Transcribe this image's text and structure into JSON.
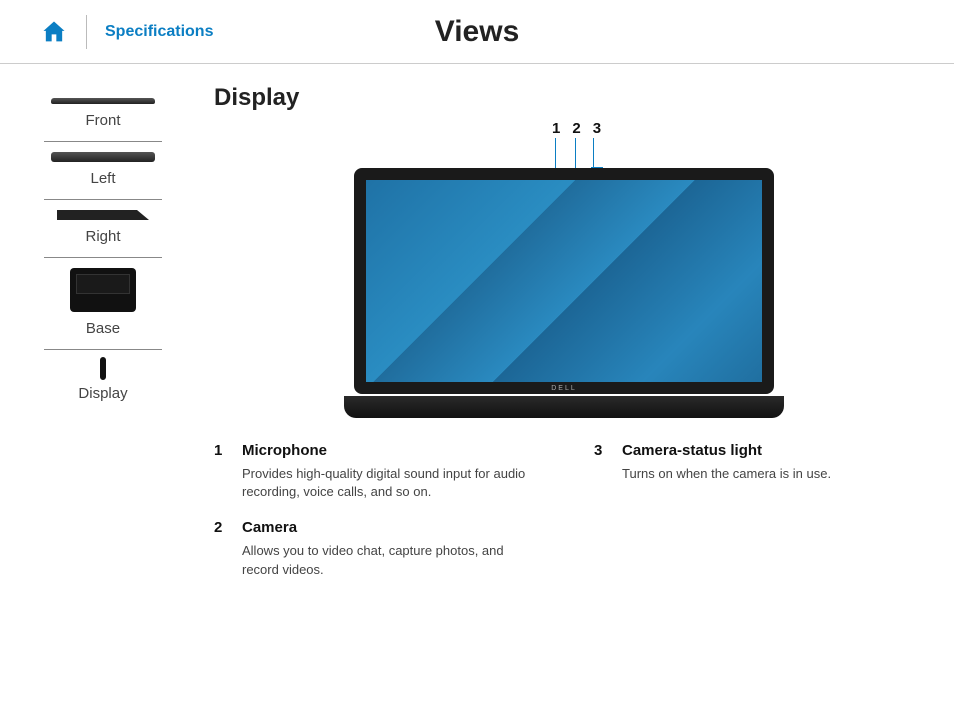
{
  "header": {
    "specifications_label": "Specifications",
    "page_title": "Views"
  },
  "sidebar": {
    "items": [
      {
        "label": "Front"
      },
      {
        "label": "Left"
      },
      {
        "label": "Right"
      },
      {
        "label": "Base"
      },
      {
        "label": "Display"
      }
    ]
  },
  "section": {
    "title": "Display",
    "brand": "DELL"
  },
  "callouts": {
    "n1": "1",
    "n2": "2",
    "n3": "3"
  },
  "descriptions": {
    "left": [
      {
        "num": "1",
        "title": "Microphone",
        "body": "Provides high-quality digital sound input for audio recording, voice calls, and so on."
      },
      {
        "num": "2",
        "title": "Camera",
        "body": "Allows you to video chat, capture photos, and record videos."
      }
    ],
    "right": [
      {
        "num": "3",
        "title": "Camera-status light",
        "body": "Turns on when the camera is in use."
      }
    ]
  }
}
